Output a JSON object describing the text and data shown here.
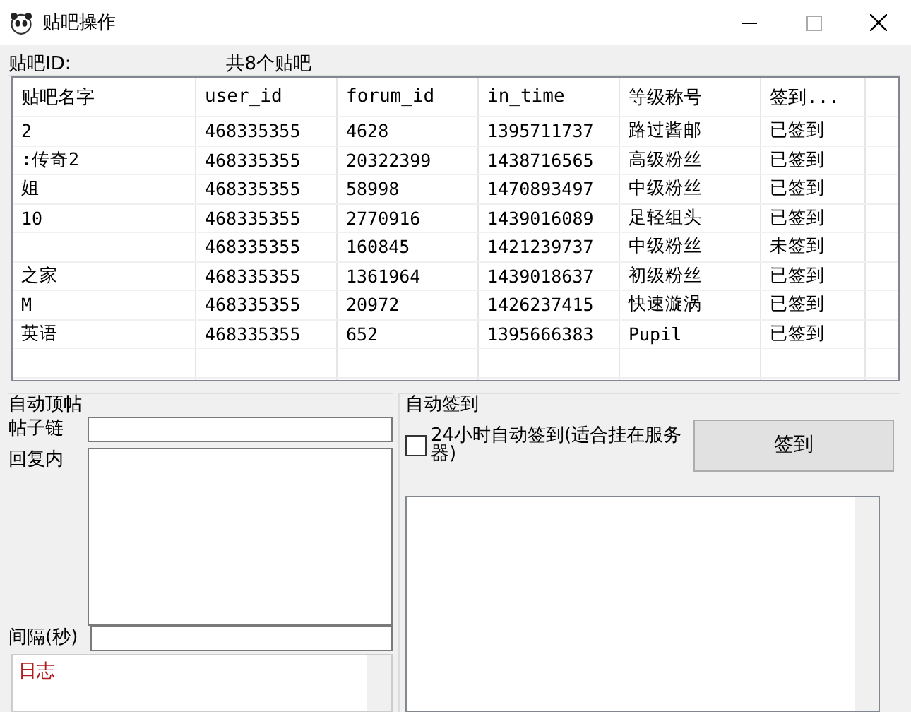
{
  "window": {
    "title": "贴吧操作",
    "buttons": [
      {
        "kind": "minimize"
      },
      {
        "kind": "maximize"
      },
      {
        "kind": "close"
      }
    ]
  },
  "header": {
    "id_label": "贴吧ID:",
    "count": "共8个贴吧"
  },
  "table": {
    "columns": [
      "贴吧名字",
      "user_id",
      "forum_id",
      "in_time",
      "等级称号",
      "签到..."
    ],
    "rows": [
      {
        "name": "2",
        "user_id": "468335355",
        "forum_id": "4628",
        "in_time": "1395711737",
        "title": "路过酱邮",
        "status": "已签到"
      },
      {
        "name": ":传奇2",
        "user_id": "468335355",
        "forum_id": "20322399",
        "in_time": "1438716565",
        "title": "高级粉丝",
        "status": "已签到"
      },
      {
        "name": "姐",
        "user_id": "468335355",
        "forum_id": "58998",
        "in_time": "1470893497",
        "title": "中级粉丝",
        "status": "已签到"
      },
      {
        "name": "10",
        "user_id": "468335355",
        "forum_id": "2770916",
        "in_time": "1439016089",
        "title": "足轻组头",
        "status": "已签到"
      },
      {
        "user_id": "468335355",
        "forum_id": "160845",
        "in_time": "1421239737",
        "title": "中级粉丝",
        "status": "未签到"
      },
      {
        "name": "之家",
        "user_id": "468335355",
        "forum_id": "1361964",
        "in_time": "1439018637",
        "title": "初级粉丝",
        "status": "已签到"
      },
      {
        "name": "M",
        "user_id": "468335355",
        "forum_id": "20972",
        "in_time": "1426237415",
        "title": "快速漩涡",
        "status": "已签到"
      },
      {
        "name": "英语",
        "user_id": "468335355",
        "forum_id": "652",
        "in_time": "1395666383",
        "title": "Pupil",
        "status": "已签到"
      }
    ]
  },
  "auto_post": {
    "title": "自动顶帖",
    "link_label": "帖子链",
    "reply_label": "回复内",
    "interval_label": "间隔(秒)",
    "log_label": "日志"
  },
  "auto_sign": {
    "title": "自动签到",
    "checkbox": {
      "label": "24小时自动签到(适合挂在服务器)",
      "checked": false
    },
    "button": "签到"
  }
}
